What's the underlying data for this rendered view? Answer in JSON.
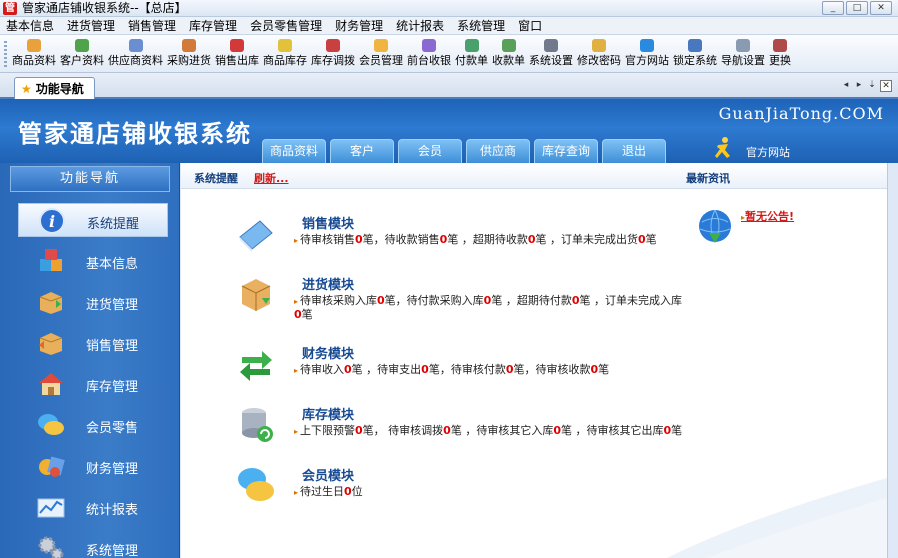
{
  "window": {
    "title": "管家通店铺收银系统--【总店】",
    "buttons": [
      "_",
      "□",
      "✕"
    ]
  },
  "menu": [
    "基本信息",
    "进货管理",
    "销售管理",
    "库存管理",
    "会员零售管理",
    "财务管理",
    "统计报表",
    "系统管理",
    "窗口"
  ],
  "toolbar": [
    {
      "label": "商品资料",
      "color": "#e9a23b"
    },
    {
      "label": "客户资料",
      "color": "#4fa34a"
    },
    {
      "label": "供应商资料",
      "color": "#6a8fd0"
    },
    {
      "label": "采购进货",
      "color": "#d27a3a"
    },
    {
      "label": "销售出库",
      "color": "#d23a3a"
    },
    {
      "label": "商品库存",
      "color": "#e2c23a"
    },
    {
      "label": "库存调拨",
      "color": "#c84040"
    },
    {
      "label": "会员管理",
      "color": "#f0b440"
    },
    {
      "label": "前台收银",
      "color": "#8a6ad0"
    },
    {
      "label": "付款单",
      "color": "#4aa06a"
    },
    {
      "label": "收款单",
      "color": "#5aa05a"
    },
    {
      "label": "系统设置",
      "color": "#707a8a"
    },
    {
      "label": "修改密码",
      "color": "#e0b040"
    },
    {
      "label": "官方网站",
      "color": "#2a8ae0"
    },
    {
      "label": "锁定系统",
      "color": "#4a78c0"
    },
    {
      "label": "导航设置",
      "color": "#8a9ab0"
    },
    {
      "label": "更换",
      "color": "#b04a4a"
    }
  ],
  "tab": {
    "label": "功能导航",
    "nav": [
      "◂",
      "▸",
      "⇣",
      "✕"
    ]
  },
  "banner": {
    "title": "管家通店铺收银系统",
    "brand": "GuanJiaTong.COM",
    "tabs": [
      "商品资料",
      "客户",
      "会员",
      "供应商",
      "库存查询",
      "退出"
    ],
    "site_label": "官方网站"
  },
  "nav": {
    "header": "功能导航",
    "items": [
      "系统提醒",
      "基本信息",
      "进货管理",
      "销售管理",
      "库存管理",
      "会员零售",
      "财务管理",
      "统计报表",
      "系统管理"
    ]
  },
  "content": {
    "bar_title": "系统提醒",
    "refresh": "刷新...",
    "news_title": "最新资讯",
    "news_item": "暂无公告!",
    "modules": [
      {
        "title": "销售模块",
        "parts": [
          "待审核销售",
          "0",
          "笔，待收款销售",
          "0",
          "笔 ，超期待收款",
          "0",
          "笔 ，订单未完成出货",
          "0",
          "笔"
        ]
      },
      {
        "title": "进货模块",
        "parts": [
          "待审核采购入库",
          "0",
          "笔，待付款采购入库",
          "0",
          "笔 ，超期待付款",
          "0",
          "笔 ，订单未完成入库",
          "0",
          "笔"
        ]
      },
      {
        "title": "财务模块",
        "parts": [
          "待审收入",
          "0",
          "笔 ，待审支出",
          "0",
          "笔，待审核付款",
          "0",
          "笔，待审核收款",
          "0",
          "笔"
        ]
      },
      {
        "title": "库存模块",
        "parts": [
          "上下限预警",
          "0",
          "笔，  待审核调拨",
          "0",
          "笔 ，待审核其它入库",
          "0",
          "笔 ，待审核其它出库",
          "0",
          "笔"
        ]
      },
      {
        "title": "会员模块",
        "parts": [
          "待过生日",
          "0",
          "位"
        ]
      }
    ]
  },
  "colors": {
    "banner": "#1d63b8",
    "nav": "#3b7cc8",
    "accent_red": "#d21a1a"
  }
}
